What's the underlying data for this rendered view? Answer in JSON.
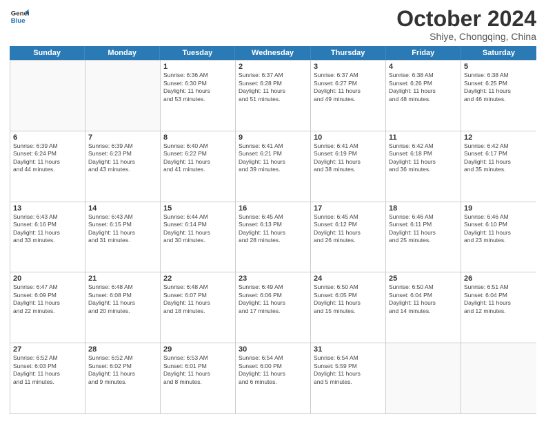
{
  "header": {
    "logo_line1": "General",
    "logo_line2": "Blue",
    "month": "October 2024",
    "location": "Shiye, Chongqing, China"
  },
  "days_of_week": [
    "Sunday",
    "Monday",
    "Tuesday",
    "Wednesday",
    "Thursday",
    "Friday",
    "Saturday"
  ],
  "weeks": [
    [
      {
        "day": "",
        "lines": []
      },
      {
        "day": "",
        "lines": []
      },
      {
        "day": "1",
        "lines": [
          "Sunrise: 6:36 AM",
          "Sunset: 6:30 PM",
          "Daylight: 11 hours",
          "and 53 minutes."
        ]
      },
      {
        "day": "2",
        "lines": [
          "Sunrise: 6:37 AM",
          "Sunset: 6:28 PM",
          "Daylight: 11 hours",
          "and 51 minutes."
        ]
      },
      {
        "day": "3",
        "lines": [
          "Sunrise: 6:37 AM",
          "Sunset: 6:27 PM",
          "Daylight: 11 hours",
          "and 49 minutes."
        ]
      },
      {
        "day": "4",
        "lines": [
          "Sunrise: 6:38 AM",
          "Sunset: 6:26 PM",
          "Daylight: 11 hours",
          "and 48 minutes."
        ]
      },
      {
        "day": "5",
        "lines": [
          "Sunrise: 6:38 AM",
          "Sunset: 6:25 PM",
          "Daylight: 11 hours",
          "and 46 minutes."
        ]
      }
    ],
    [
      {
        "day": "6",
        "lines": [
          "Sunrise: 6:39 AM",
          "Sunset: 6:24 PM",
          "Daylight: 11 hours",
          "and 44 minutes."
        ]
      },
      {
        "day": "7",
        "lines": [
          "Sunrise: 6:39 AM",
          "Sunset: 6:23 PM",
          "Daylight: 11 hours",
          "and 43 minutes."
        ]
      },
      {
        "day": "8",
        "lines": [
          "Sunrise: 6:40 AM",
          "Sunset: 6:22 PM",
          "Daylight: 11 hours",
          "and 41 minutes."
        ]
      },
      {
        "day": "9",
        "lines": [
          "Sunrise: 6:41 AM",
          "Sunset: 6:21 PM",
          "Daylight: 11 hours",
          "and 39 minutes."
        ]
      },
      {
        "day": "10",
        "lines": [
          "Sunrise: 6:41 AM",
          "Sunset: 6:19 PM",
          "Daylight: 11 hours",
          "and 38 minutes."
        ]
      },
      {
        "day": "11",
        "lines": [
          "Sunrise: 6:42 AM",
          "Sunset: 6:18 PM",
          "Daylight: 11 hours",
          "and 36 minutes."
        ]
      },
      {
        "day": "12",
        "lines": [
          "Sunrise: 6:42 AM",
          "Sunset: 6:17 PM",
          "Daylight: 11 hours",
          "and 35 minutes."
        ]
      }
    ],
    [
      {
        "day": "13",
        "lines": [
          "Sunrise: 6:43 AM",
          "Sunset: 6:16 PM",
          "Daylight: 11 hours",
          "and 33 minutes."
        ]
      },
      {
        "day": "14",
        "lines": [
          "Sunrise: 6:43 AM",
          "Sunset: 6:15 PM",
          "Daylight: 11 hours",
          "and 31 minutes."
        ]
      },
      {
        "day": "15",
        "lines": [
          "Sunrise: 6:44 AM",
          "Sunset: 6:14 PM",
          "Daylight: 11 hours",
          "and 30 minutes."
        ]
      },
      {
        "day": "16",
        "lines": [
          "Sunrise: 6:45 AM",
          "Sunset: 6:13 PM",
          "Daylight: 11 hours",
          "and 28 minutes."
        ]
      },
      {
        "day": "17",
        "lines": [
          "Sunrise: 6:45 AM",
          "Sunset: 6:12 PM",
          "Daylight: 11 hours",
          "and 26 minutes."
        ]
      },
      {
        "day": "18",
        "lines": [
          "Sunrise: 6:46 AM",
          "Sunset: 6:11 PM",
          "Daylight: 11 hours",
          "and 25 minutes."
        ]
      },
      {
        "day": "19",
        "lines": [
          "Sunrise: 6:46 AM",
          "Sunset: 6:10 PM",
          "Daylight: 11 hours",
          "and 23 minutes."
        ]
      }
    ],
    [
      {
        "day": "20",
        "lines": [
          "Sunrise: 6:47 AM",
          "Sunset: 6:09 PM",
          "Daylight: 11 hours",
          "and 22 minutes."
        ]
      },
      {
        "day": "21",
        "lines": [
          "Sunrise: 6:48 AM",
          "Sunset: 6:08 PM",
          "Daylight: 11 hours",
          "and 20 minutes."
        ]
      },
      {
        "day": "22",
        "lines": [
          "Sunrise: 6:48 AM",
          "Sunset: 6:07 PM",
          "Daylight: 11 hours",
          "and 18 minutes."
        ]
      },
      {
        "day": "23",
        "lines": [
          "Sunrise: 6:49 AM",
          "Sunset: 6:06 PM",
          "Daylight: 11 hours",
          "and 17 minutes."
        ]
      },
      {
        "day": "24",
        "lines": [
          "Sunrise: 6:50 AM",
          "Sunset: 6:05 PM",
          "Daylight: 11 hours",
          "and 15 minutes."
        ]
      },
      {
        "day": "25",
        "lines": [
          "Sunrise: 6:50 AM",
          "Sunset: 6:04 PM",
          "Daylight: 11 hours",
          "and 14 minutes."
        ]
      },
      {
        "day": "26",
        "lines": [
          "Sunrise: 6:51 AM",
          "Sunset: 6:04 PM",
          "Daylight: 11 hours",
          "and 12 minutes."
        ]
      }
    ],
    [
      {
        "day": "27",
        "lines": [
          "Sunrise: 6:52 AM",
          "Sunset: 6:03 PM",
          "Daylight: 11 hours",
          "and 11 minutes."
        ]
      },
      {
        "day": "28",
        "lines": [
          "Sunrise: 6:52 AM",
          "Sunset: 6:02 PM",
          "Daylight: 11 hours",
          "and 9 minutes."
        ]
      },
      {
        "day": "29",
        "lines": [
          "Sunrise: 6:53 AM",
          "Sunset: 6:01 PM",
          "Daylight: 11 hours",
          "and 8 minutes."
        ]
      },
      {
        "day": "30",
        "lines": [
          "Sunrise: 6:54 AM",
          "Sunset: 6:00 PM",
          "Daylight: 11 hours",
          "and 6 minutes."
        ]
      },
      {
        "day": "31",
        "lines": [
          "Sunrise: 6:54 AM",
          "Sunset: 5:59 PM",
          "Daylight: 11 hours",
          "and 5 minutes."
        ]
      },
      {
        "day": "",
        "lines": []
      },
      {
        "day": "",
        "lines": []
      }
    ]
  ]
}
